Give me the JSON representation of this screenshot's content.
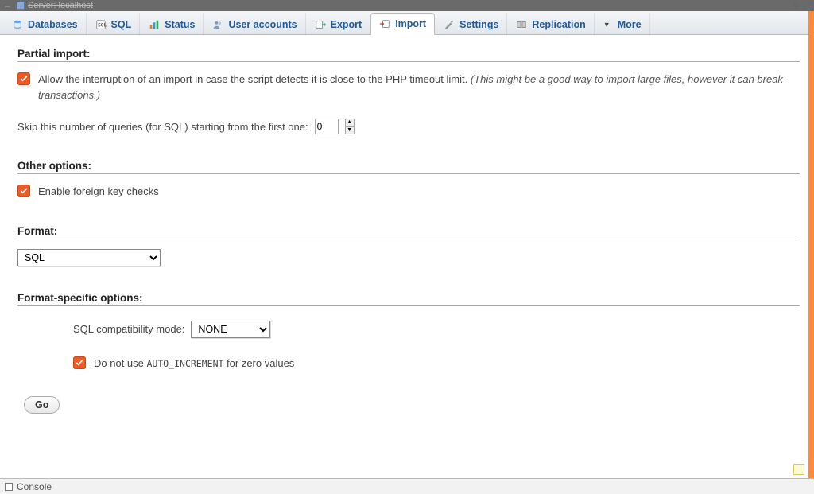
{
  "titlebar": {
    "server_label": "Server: localhost"
  },
  "tabs": {
    "databases": "Databases",
    "sql": "SQL",
    "status": "Status",
    "user_accounts": "User accounts",
    "export": "Export",
    "import": "Import",
    "settings": "Settings",
    "replication": "Replication",
    "more": "More"
  },
  "partial_import": {
    "title": "Partial import:",
    "allow_interruption_label": "Allow the interruption of an import in case the script detects it is close to the PHP timeout limit.",
    "allow_interruption_hint": "(This might be a good way to import large files, however it can break transactions.)",
    "skip_label": "Skip this number of queries (for SQL) starting from the first one:",
    "skip_value": "0"
  },
  "other_options": {
    "title": "Other options:",
    "foreign_key_label": "Enable foreign key checks"
  },
  "format": {
    "title": "Format:",
    "selected": "SQL"
  },
  "format_specific": {
    "title": "Format-specific options:",
    "compat_label": "SQL compatibility mode:",
    "compat_selected": "NONE",
    "no_auto_increment_prefix": "Do not use ",
    "no_auto_increment_code": "AUTO_INCREMENT",
    "no_auto_increment_suffix": " for zero values"
  },
  "buttons": {
    "go": "Go"
  },
  "footer": {
    "console": "Console"
  }
}
